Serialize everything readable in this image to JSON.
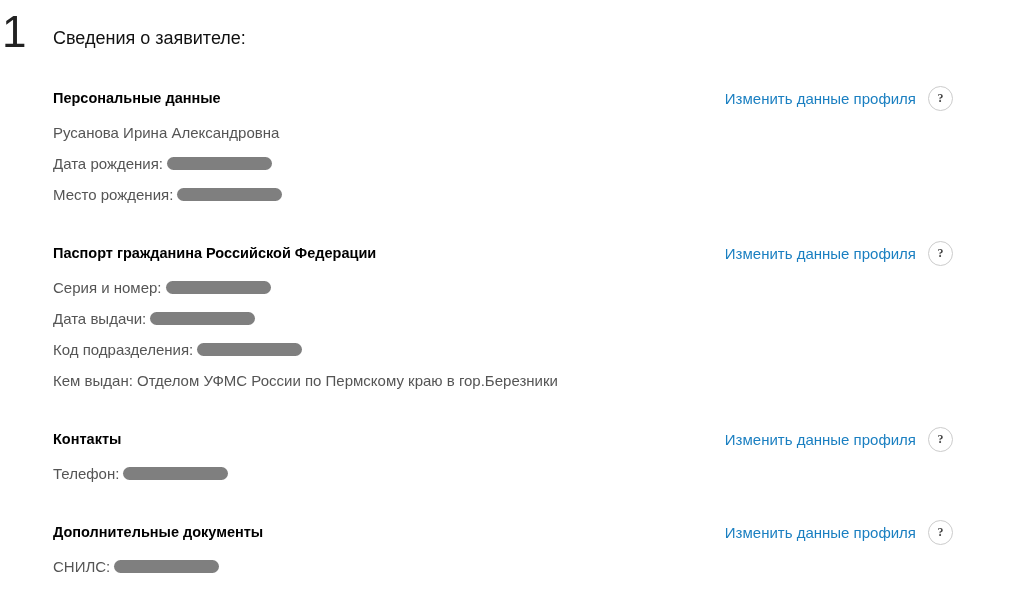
{
  "step": "1",
  "title": "Сведения о заявителе:",
  "sections": [
    {
      "heading": "Персональные данные",
      "link": "Изменить данные профиля",
      "help": "?",
      "lines": [
        {
          "text": "Русанова Ирина Александровна",
          "redacted": false
        },
        {
          "text": "Дата рождения:",
          "redacted": true
        },
        {
          "text": "Место рождения:",
          "redacted": true
        }
      ]
    },
    {
      "heading": "Паспорт гражданина Российской Федерации",
      "link": "Изменить данные профиля",
      "help": "?",
      "lines": [
        {
          "text": "Серия и номер:",
          "redacted": true
        },
        {
          "text": "Дата выдачи:",
          "redacted": true
        },
        {
          "text": "Код подразделения:",
          "redacted": true
        },
        {
          "text": "Кем выдан: Отделом УФМС России по Пермскому краю в гор.Березники",
          "redacted": false
        }
      ]
    },
    {
      "heading": "Контакты",
      "link": "Изменить данные профиля",
      "help": "?",
      "lines": [
        {
          "text": "Телефон:",
          "redacted": true
        }
      ]
    },
    {
      "heading": "Дополнительные документы",
      "link": "Изменить данные профиля",
      "help": "?",
      "lines": [
        {
          "text": "СНИЛС:",
          "redacted": true
        }
      ]
    }
  ]
}
